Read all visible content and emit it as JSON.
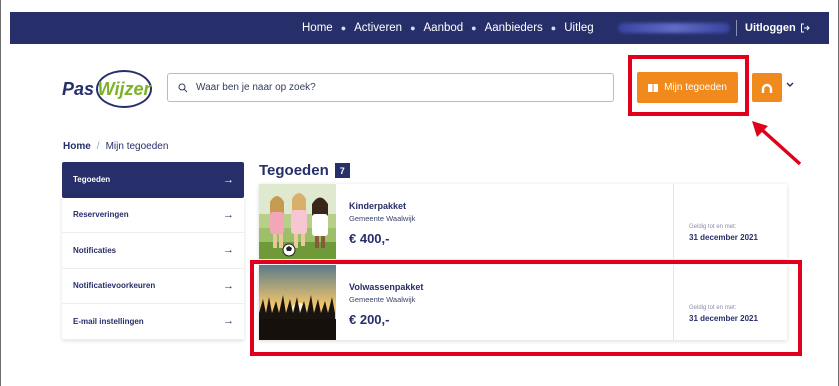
{
  "nav": {
    "links": [
      "Home",
      "Activeren",
      "Aanbod",
      "Aanbieders",
      "Uitleg"
    ],
    "logout_label": "Uitloggen"
  },
  "logo": {
    "part1": "Pas",
    "part2": "Wijzer"
  },
  "search": {
    "placeholder": "Waar ben je naar op zoek?"
  },
  "header": {
    "mijn_tegoeden_label": "Mijn tegoeden"
  },
  "breadcrumb": {
    "home": "Home",
    "separator": "/",
    "current": "Mijn tegoeden"
  },
  "sidebar": {
    "items": [
      {
        "label": "Tegoeden",
        "active": true
      },
      {
        "label": "Reserveringen",
        "active": false
      },
      {
        "label": "Notificaties",
        "active": false
      },
      {
        "label": "Notificatievoorkeuren",
        "active": false
      },
      {
        "label": "E-mail instellingen",
        "active": false
      }
    ],
    "arrow": "→"
  },
  "main": {
    "title": "Tegoeden",
    "count": "7",
    "cards": [
      {
        "name": "Kinderpakket",
        "organisation": "Gemeente Waalwijk",
        "amount": "€ 400,-",
        "valid_label": "Geldig tot en met:",
        "valid_date": "31 december 2021"
      },
      {
        "name": "Volwassenpakket",
        "organisation": "Gemeente Waalwijk",
        "amount": "€ 200,-",
        "valid_label": "Geldig tot en met:",
        "valid_date": "31 december 2021"
      }
    ]
  },
  "colors": {
    "navy": "#262f6a",
    "orange": "#f08a1d",
    "green": "#7bb226",
    "highlight_red": "#e0001b"
  }
}
